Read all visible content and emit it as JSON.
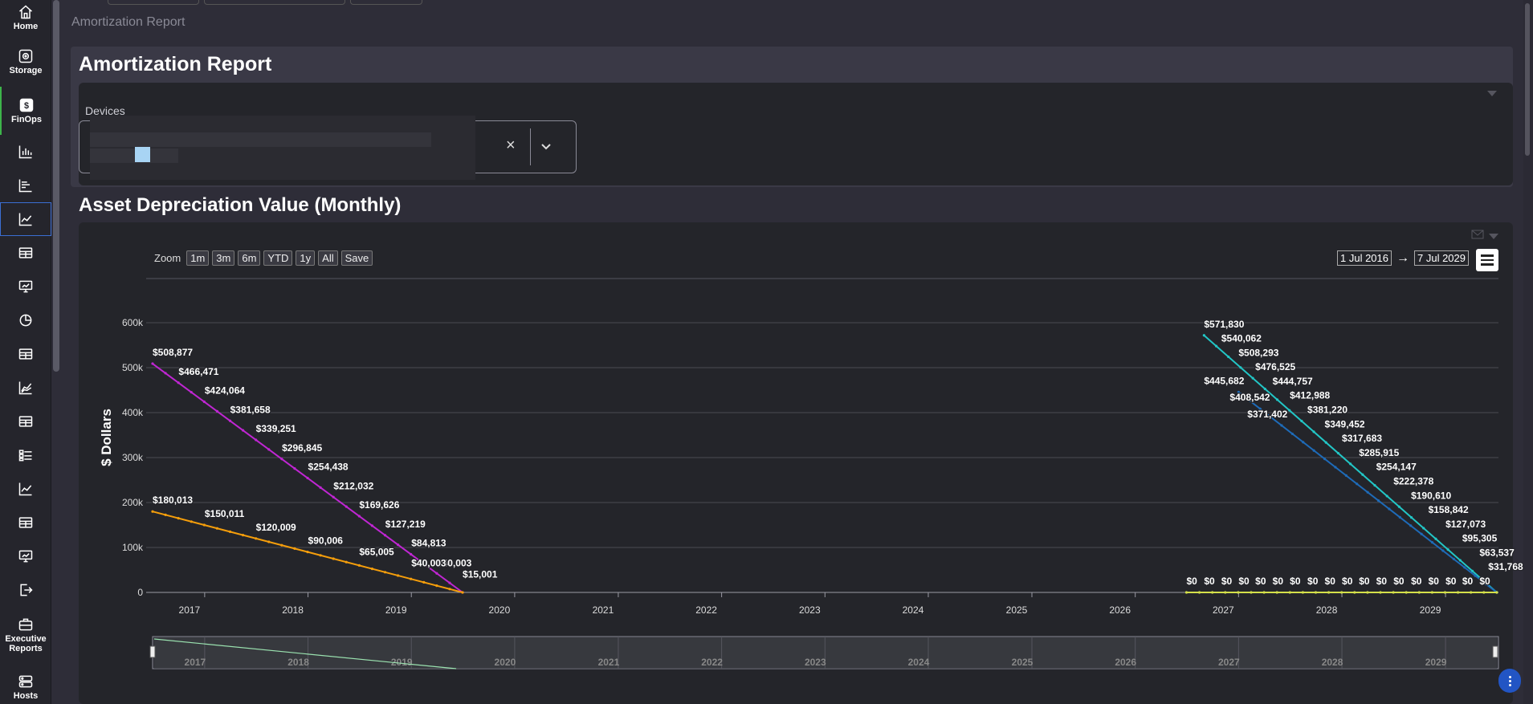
{
  "sidebar": {
    "items": [
      {
        "label": "Home",
        "icon": "home-icon"
      },
      {
        "label": "Storage",
        "icon": "storage-icon"
      },
      {
        "label": "FinOps",
        "icon": "dollar-icon"
      },
      {
        "label": "",
        "icon": "bar-chart-icon"
      },
      {
        "label": "",
        "icon": "horizontal-bars-icon"
      },
      {
        "label": "",
        "icon": "line-chart-icon"
      },
      {
        "label": "",
        "icon": "table-icon"
      },
      {
        "label": "",
        "icon": "monitor-chart-icon"
      },
      {
        "label": "",
        "icon": "pie-chart-icon"
      },
      {
        "label": "",
        "icon": "table-icon"
      },
      {
        "label": "",
        "icon": "area-chart-icon"
      },
      {
        "label": "",
        "icon": "table-icon"
      },
      {
        "label": "",
        "icon": "list-icon"
      },
      {
        "label": "",
        "icon": "line-chart-icon"
      },
      {
        "label": "",
        "icon": "table-icon"
      },
      {
        "label": "",
        "icon": "monitor-chart-icon"
      },
      {
        "label": "",
        "icon": "export-icon"
      },
      {
        "label": "Executive Reports",
        "icon": "briefcase-icon"
      },
      {
        "label": "Hosts",
        "icon": "server-icon"
      }
    ]
  },
  "breadcrumb": "Amortization Report",
  "report": {
    "title": "Amortization Report",
    "devices_label": "Devices"
  },
  "chart_section": {
    "title": "Asset Depreciation Value (Monthly)",
    "zoom_label": "Zoom",
    "zoom_buttons": [
      "1m",
      "3m",
      "6m",
      "YTD",
      "1y",
      "All",
      "Save"
    ],
    "date_from": "1 Jul 2016",
    "date_arrow": "→",
    "date_to": "7 Jul 2029"
  },
  "chart_data": {
    "type": "line",
    "title": "",
    "xlabel": "",
    "ylabel": "$ Dollars",
    "ylim": [
      0,
      600000
    ],
    "y_ticks": [
      "0",
      "100k",
      "200k",
      "300k",
      "400k",
      "500k",
      "600k"
    ],
    "x_range": [
      "2016-07-01",
      "2029-07-07"
    ],
    "x_ticks": [
      "2017",
      "2018",
      "2019",
      "2020",
      "2021",
      "2022",
      "2023",
      "2024",
      "2025",
      "2026",
      "2027",
      "2028",
      "2029"
    ],
    "grid": true,
    "series": [
      {
        "color": "#c026d3",
        "x": [
          "2016-07-01",
          "2019-07-01"
        ],
        "y": [
          508877,
          0
        ],
        "labels": [
          {
            "x": "2016-07-01",
            "y": 508877,
            "text": "$508,877"
          },
          {
            "x": "2016-10-01",
            "y": 466471,
            "text": "$466,471"
          },
          {
            "x": "2017-01-01",
            "y": 424064,
            "text": "$424,064"
          },
          {
            "x": "2017-04-01",
            "y": 381658,
            "text": "$381,658"
          },
          {
            "x": "2017-07-01",
            "y": 339251,
            "text": "$339,251"
          },
          {
            "x": "2017-10-01",
            "y": 296845,
            "text": "$296,845"
          },
          {
            "x": "2018-01-01",
            "y": 254438,
            "text": "$254,438"
          },
          {
            "x": "2018-04-01",
            "y": 212032,
            "text": "$212,032"
          },
          {
            "x": "2018-07-01",
            "y": 169626,
            "text": "$169,626"
          },
          {
            "x": "2018-10-01",
            "y": 127219,
            "text": "$127,219"
          },
          {
            "x": "2019-01-01",
            "y": 84813,
            "text": "$84,813"
          },
          {
            "x": "2019-04-01",
            "y": 40003,
            "text": "$40,003"
          },
          {
            "x": "2019-07-01",
            "y": 15001,
            "text": "$15,001"
          }
        ]
      },
      {
        "color": "#f59e0b",
        "x": [
          "2016-07-01",
          "2019-07-01"
        ],
        "y": [
          180013,
          0
        ],
        "labels": [
          {
            "x": "2016-07-01",
            "y": 180013,
            "text": "$180,013"
          },
          {
            "x": "2017-01-01",
            "y": 150011,
            "text": "$150,011"
          },
          {
            "x": "2017-07-01",
            "y": 120009,
            "text": "$120,009"
          },
          {
            "x": "2018-01-01",
            "y": 90006,
            "text": "$90,006"
          },
          {
            "x": "2018-07-01",
            "y": 65005,
            "text": "$65,005"
          },
          {
            "x": "2019-01-01",
            "y": 40003,
            "text": "$40,003"
          }
        ]
      },
      {
        "color": "#22c6c6",
        "x": [
          "2026-09-01",
          "2029-07-01"
        ],
        "y": [
          571830,
          0
        ],
        "labels": [
          {
            "x": "2026-09-01",
            "y": 571830,
            "text": "$571,830"
          },
          {
            "x": "2026-11-01",
            "y": 540062,
            "text": "$540,062"
          },
          {
            "x": "2027-01-01",
            "y": 508293,
            "text": "$508,293"
          },
          {
            "x": "2027-03-01",
            "y": 476525,
            "text": "$476,525"
          },
          {
            "x": "2027-05-01",
            "y": 444757,
            "text": "$444,757"
          },
          {
            "x": "2027-07-01",
            "y": 412988,
            "text": "$412,988"
          },
          {
            "x": "2027-09-01",
            "y": 381220,
            "text": "$381,220"
          },
          {
            "x": "2027-11-01",
            "y": 349452,
            "text": "$349,452"
          },
          {
            "x": "2028-01-01",
            "y": 317683,
            "text": "$317,683"
          },
          {
            "x": "2028-03-01",
            "y": 285915,
            "text": "$285,915"
          },
          {
            "x": "2028-05-01",
            "y": 254147,
            "text": "$254,147"
          },
          {
            "x": "2028-07-01",
            "y": 222378,
            "text": "$222,378"
          },
          {
            "x": "2028-09-01",
            "y": 190610,
            "text": "$190,610"
          },
          {
            "x": "2028-11-01",
            "y": 158842,
            "text": "$158,842"
          },
          {
            "x": "2029-01-01",
            "y": 127073,
            "text": "$127,073"
          },
          {
            "x": "2029-03-01",
            "y": 95305,
            "text": "$95,305"
          },
          {
            "x": "2029-05-01",
            "y": 63537,
            "text": "$63,537"
          },
          {
            "x": "2029-06-01",
            "y": 31768,
            "text": "$31,768"
          }
        ]
      },
      {
        "color": "#1e6bb8",
        "x": [
          "2027-01-01",
          "2029-07-01"
        ],
        "y": [
          445682,
          0
        ],
        "labels": [
          {
            "x": "2026-09-01",
            "y": 445682,
            "text": "$445,682"
          },
          {
            "x": "2026-12-01",
            "y": 408542,
            "text": "$408,542"
          },
          {
            "x": "2027-02-01",
            "y": 371402,
            "text": "$371,402"
          }
        ]
      },
      {
        "color": "#d4e04a",
        "x": [
          "2026-07-01",
          "2029-07-01"
        ],
        "y": [
          0,
          0
        ],
        "labels": [
          {
            "x": "2026-07-01",
            "y": 0,
            "text": "$0"
          },
          {
            "x": "2026-09-01",
            "y": 0,
            "text": "$0"
          },
          {
            "x": "2026-11-01",
            "y": 0,
            "text": "$0"
          },
          {
            "x": "2027-01-01",
            "y": 0,
            "text": "$0"
          },
          {
            "x": "2027-03-01",
            "y": 0,
            "text": "$0"
          },
          {
            "x": "2027-05-01",
            "y": 0,
            "text": "$0"
          },
          {
            "x": "2027-07-01",
            "y": 0,
            "text": "$0"
          },
          {
            "x": "2027-09-01",
            "y": 0,
            "text": "$0"
          },
          {
            "x": "2027-11-01",
            "y": 0,
            "text": "$0"
          },
          {
            "x": "2028-01-01",
            "y": 0,
            "text": "$0"
          },
          {
            "x": "2028-03-01",
            "y": 0,
            "text": "$0"
          },
          {
            "x": "2028-05-01",
            "y": 0,
            "text": "$0"
          },
          {
            "x": "2028-07-01",
            "y": 0,
            "text": "$0"
          },
          {
            "x": "2028-09-01",
            "y": 0,
            "text": "$0"
          },
          {
            "x": "2028-11-01",
            "y": 0,
            "text": "$0"
          },
          {
            "x": "2029-01-01",
            "y": 0,
            "text": "$0"
          },
          {
            "x": "2029-03-01",
            "y": 0,
            "text": "$0"
          },
          {
            "x": "2029-05-01",
            "y": 0,
            "text": "$0"
          }
        ]
      }
    ],
    "navigator": {
      "x_ticks": [
        "2017",
        "2018",
        "2019",
        "2020",
        "2021",
        "2022",
        "2023",
        "2024",
        "2025",
        "2026",
        "2027",
        "2028",
        "2029"
      ]
    }
  }
}
